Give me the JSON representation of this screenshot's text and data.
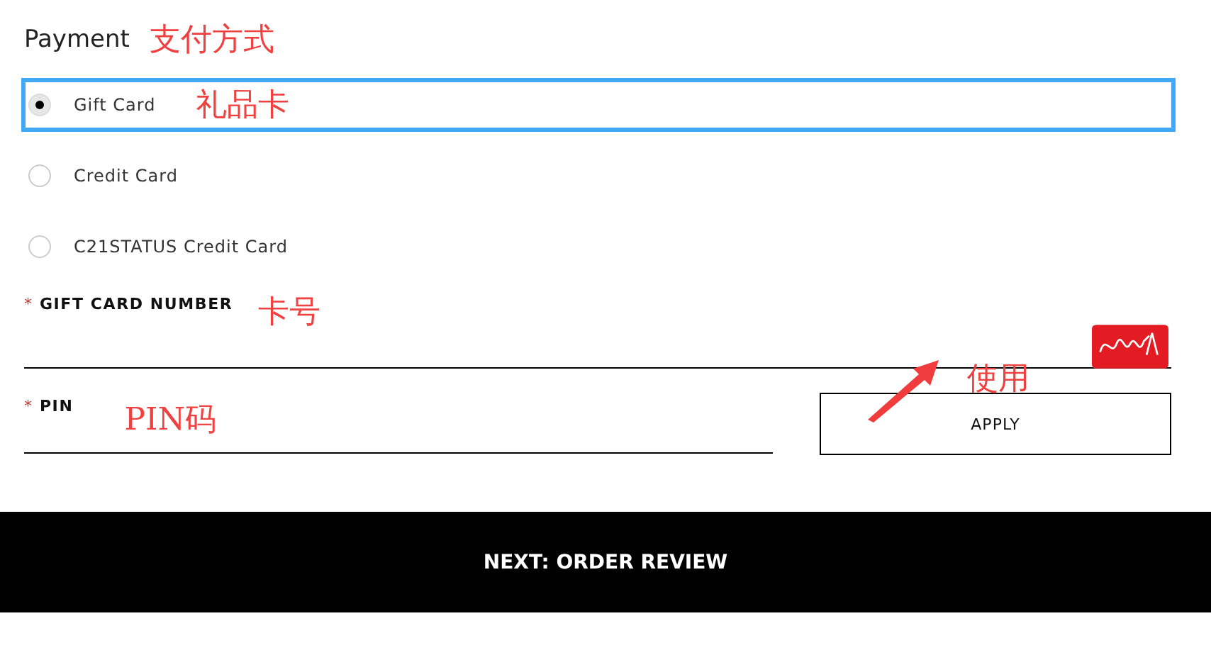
{
  "payment": {
    "title": "Payment",
    "annotation": "支付方式"
  },
  "methods": [
    {
      "label": "Gift Card",
      "selected": true,
      "highlighted": true,
      "annotation": "礼品卡"
    },
    {
      "label": "Credit Card",
      "selected": false,
      "highlighted": false
    },
    {
      "label": "C21STATUS Credit Card",
      "selected": false,
      "highlighted": false
    }
  ],
  "card_number": {
    "required_mark": "*",
    "label": "GIFT CARD NUMBER",
    "annotation": "卡号"
  },
  "pin": {
    "required_mark": "*",
    "label": "PIN",
    "annotation": "PIN码"
  },
  "apply_button": {
    "label": "APPLY",
    "annotation": "使用"
  },
  "next_button": {
    "label": "NEXT: ORDER REVIEW"
  }
}
